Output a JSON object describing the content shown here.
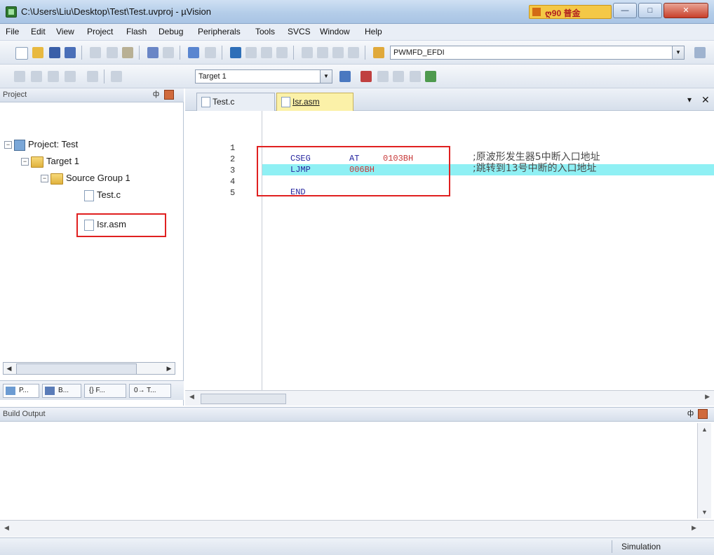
{
  "window": {
    "title": "C:\\Users\\Liu\\Desktop\\Test\\Test.uvproj - µVision",
    "badge": "ღ90 普金",
    "controls": {
      "minimize": "—",
      "maximize": "□",
      "close": "✕"
    }
  },
  "menu": [
    "File",
    "Edit",
    "View",
    "Project",
    "Flash",
    "Debug",
    "Peripherals",
    "Tools",
    "SVCS",
    "Window",
    "Help"
  ],
  "toolbar": {
    "find_combo_value": "PWMFD_EFDI",
    "target_combo_value": "Target 1"
  },
  "project_panel": {
    "title": "Project",
    "pin": "ф",
    "tree": {
      "project": "Project: Test",
      "target": "Target 1",
      "group": "Source Group 1",
      "files": [
        "Test.c",
        "Isr.asm"
      ]
    },
    "tabs": [
      "P...",
      "B...",
      "{} F...",
      "0→ T..."
    ]
  },
  "editor": {
    "tabs": [
      {
        "label": "Test.c",
        "active": false
      },
      {
        "label": "Isr.asm",
        "active": true
      }
    ],
    "tab_menu_icon": "▾",
    "tab_close_icon": "✕",
    "line_numbers": [
      "1",
      "2",
      "3",
      "4",
      "5"
    ],
    "lines": [
      {
        "instr": "",
        "op": "",
        "arg": "",
        "comment": ""
      },
      {
        "instr": "CSEG",
        "op": "AT",
        "arg": "0103BH",
        "comment": ";原波形发生器5中断入口地址"
      },
      {
        "instr": "LJMP",
        "op": "",
        "arg": "006BH",
        "comment": ";跳转到13号中断的入口地址"
      },
      {
        "instr": "",
        "op": "",
        "arg": "",
        "comment": ""
      },
      {
        "instr": "END",
        "op": "",
        "arg": "",
        "comment": ""
      }
    ]
  },
  "build_output": {
    "title": "Build Output",
    "pin": "ф"
  },
  "status_bar": {
    "mode": "Simulation"
  },
  "colors": {
    "current_line_highlight": "#8ff0f4",
    "callout_box": "#e02020",
    "keyword": "#2727a0",
    "number": "#c83a3a"
  }
}
